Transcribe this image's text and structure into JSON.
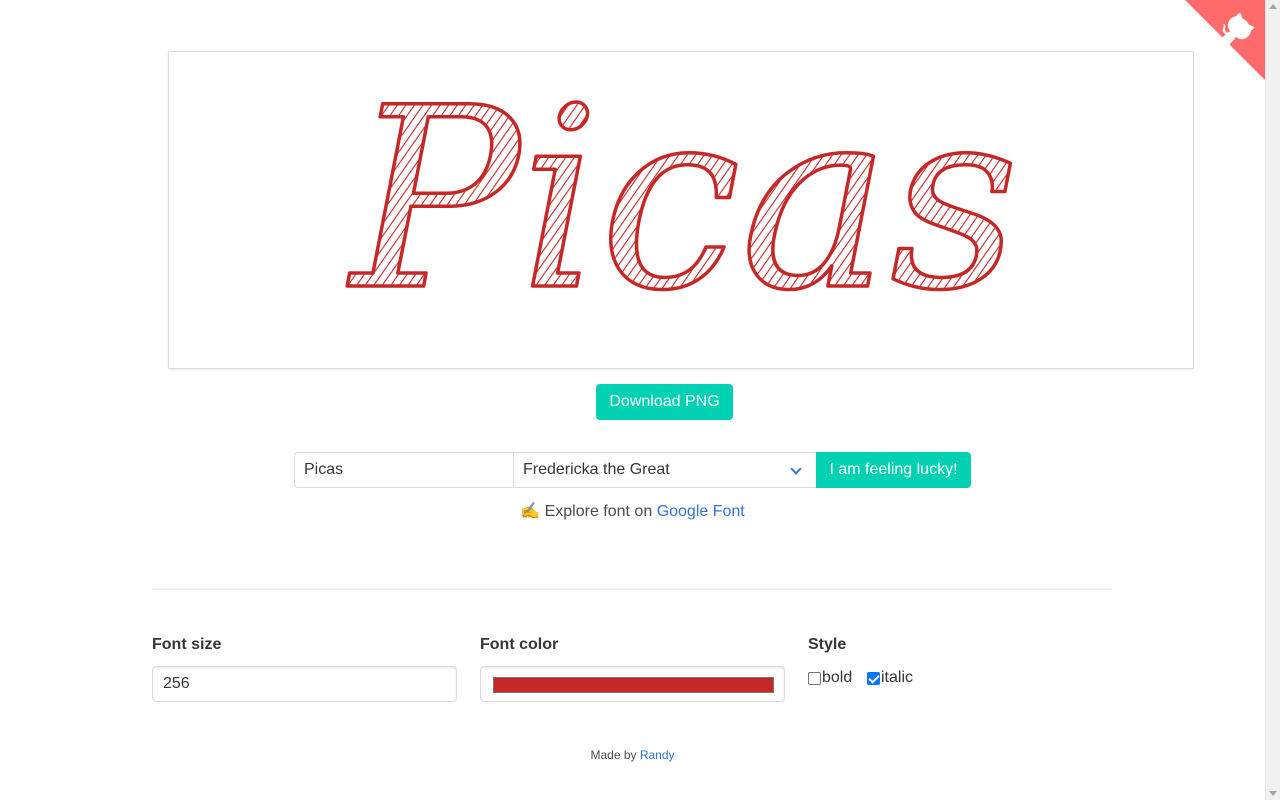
{
  "preview": {
    "text": "Picas",
    "color": "#c62828",
    "font_name": "Fredericka the Great"
  },
  "actions": {
    "download_label": "Download PNG",
    "lucky_label": "I am feeling lucky!"
  },
  "controls": {
    "text_value": "Picas",
    "font_selected": "Fredericka the Great",
    "explore_prefix": "✍️ Explore font on",
    "explore_link": "Google Font"
  },
  "settings": {
    "font_size_label": "Font size",
    "font_size_value": "256",
    "font_color_label": "Font color",
    "font_color_value": "#c62828",
    "style_label": "Style",
    "bold_label": "bold",
    "bold_checked": false,
    "italic_label": "italic",
    "italic_checked": true
  },
  "footer": {
    "prefix": "Made by",
    "author": "Randy"
  },
  "colors": {
    "accent": "#00d1b2",
    "link": "#3273dc",
    "corner": "#ff6b6b"
  }
}
